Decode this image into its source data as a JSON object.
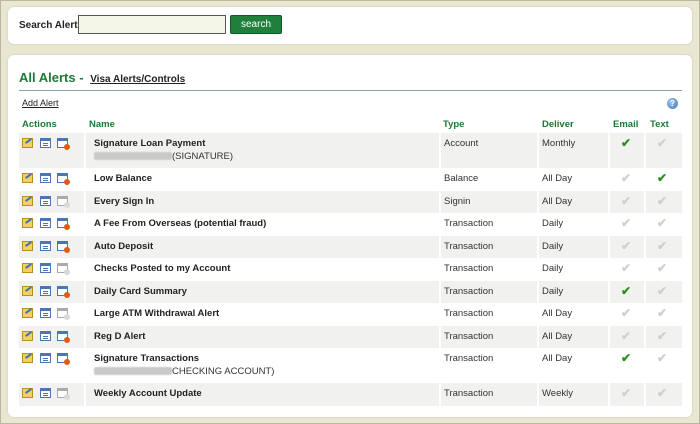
{
  "search": {
    "label": "Search Alerts:",
    "value": "",
    "button_label": "search"
  },
  "page": {
    "title": "All Alerts",
    "dash": "-",
    "title_link": "Visa Alerts/Controls",
    "add_alert": "Add Alert",
    "help_glyph": "?"
  },
  "columns": {
    "actions": "Actions",
    "name": "Name",
    "type": "Type",
    "deliver": "Deliver",
    "email": "Email",
    "text": "Text"
  },
  "icons": {
    "edit": "edit-alert-icon",
    "view": "view-alert-icon",
    "delete": "delete-alert-icon",
    "check": "checkmark-icon",
    "help": "help-icon"
  },
  "colors": {
    "accent_green": "#1d7a35",
    "button_green": "#1f7f3b",
    "check_on": "#2e8f1f",
    "check_off": "#cfcfcf",
    "row_shade": "#f1f2ef",
    "background": "#e9e7d2"
  },
  "alerts": [
    {
      "name": "Signature Loan Payment",
      "sub": "(SIGNATURE)",
      "type": "Account",
      "deliver": "Monthly",
      "email": true,
      "text": false,
      "delete_active": true,
      "tall": true
    },
    {
      "name": "Low Balance",
      "type": "Balance",
      "deliver": "All Day",
      "email": false,
      "text": true,
      "delete_active": true
    },
    {
      "name": "Every Sign In",
      "type": "Signin",
      "deliver": "All Day",
      "email": false,
      "text": false,
      "delete_active": false
    },
    {
      "name": "A Fee From Overseas (potential fraud)",
      "type": "Transaction",
      "deliver": "Daily",
      "email": false,
      "text": false,
      "delete_active": true
    },
    {
      "name": "Auto Deposit",
      "type": "Transaction",
      "deliver": "Daily",
      "email": false,
      "text": false,
      "delete_active": true
    },
    {
      "name": "Checks Posted to my Account",
      "type": "Transaction",
      "deliver": "Daily",
      "email": false,
      "text": false,
      "delete_active": false
    },
    {
      "name": "Daily Card Summary",
      "type": "Transaction",
      "deliver": "Daily",
      "email": true,
      "text": false,
      "delete_active": true
    },
    {
      "name": "Large ATM Withdrawal Alert",
      "type": "Transaction",
      "deliver": "All Day",
      "email": false,
      "text": false,
      "delete_active": false
    },
    {
      "name": "Reg D Alert",
      "type": "Transaction",
      "deliver": "All Day",
      "email": false,
      "text": false,
      "delete_active": true
    },
    {
      "name": "Signature Transactions",
      "sub": "CHECKING ACCOUNT)",
      "type": "Transaction",
      "deliver": "All Day",
      "email": true,
      "text": false,
      "delete_active": true,
      "tall": true
    },
    {
      "name": "Weekly Account Update",
      "type": "Transaction",
      "deliver": "Weekly",
      "email": false,
      "text": false,
      "delete_active": false
    }
  ]
}
